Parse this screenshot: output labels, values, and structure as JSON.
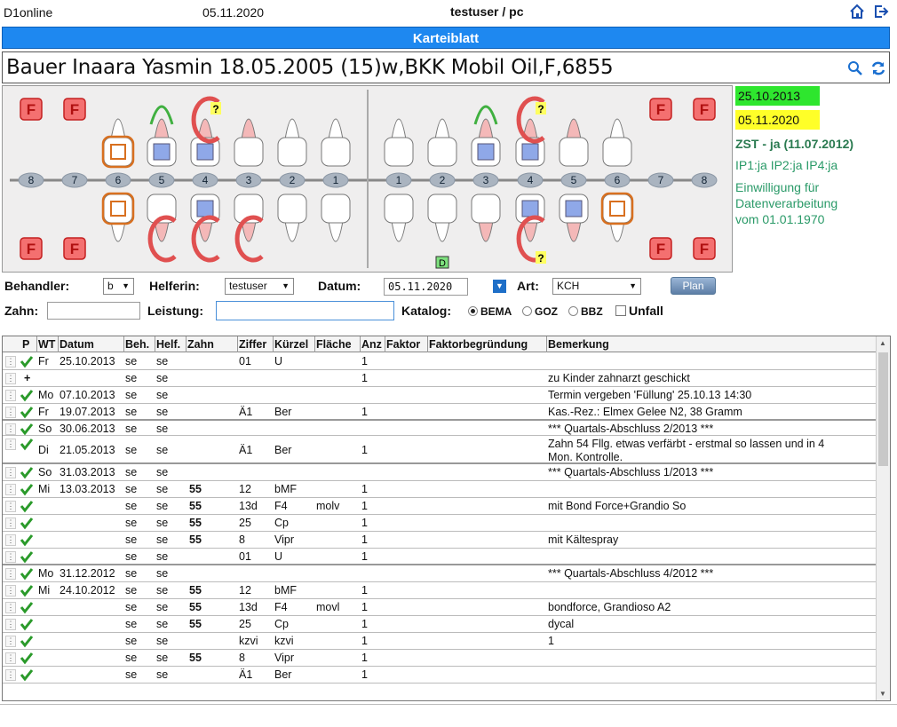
{
  "header": {
    "app": "D1online",
    "date": "05.11.2020",
    "user": "testuser / pc"
  },
  "title": "Karteiblatt",
  "patient": "Bauer Inaara Yasmin 18.05.2005 (15)w,BKK Mobil Oil,F,6855",
  "side": {
    "date1": "25.10.2013",
    "date2": "05.11.2020",
    "zst": "ZST - ja (11.07.2012)",
    "ip": "IP1:ja IP2:ja IP4:ja",
    "ein": [
      "Einwilligung für",
      "Datenverarbeitung",
      "vom 01.01.1970"
    ]
  },
  "teeth": {
    "numbers": [
      "8",
      "7",
      "6",
      "5",
      "4",
      "3",
      "2",
      "1",
      "1",
      "2",
      "3",
      "4",
      "5",
      "6",
      "7",
      "8"
    ],
    "marks": {
      "f": "F",
      "q": "?",
      "d": "D"
    }
  },
  "form": {
    "behandler_label": "Behandler:",
    "behandler_value": "b",
    "helferin_label": "Helferin:",
    "helferin_value": "testuser",
    "datum_label": "Datum:",
    "datum_value": "05.11.2020",
    "art_label": "Art:",
    "art_value": "KCH",
    "plan": "Plan",
    "zahn_label": "Zahn:",
    "leistung_label": "Leistung:",
    "katalog_label": "Katalog:",
    "radios": [
      "BEMA",
      "GOZ",
      "BBZ"
    ],
    "unfall": "Unfall"
  },
  "table": {
    "columns": [
      "P",
      "WT",
      "Datum",
      "Beh.",
      "Helf.",
      "Zahn",
      "Ziffer",
      "Kürzel",
      "Fläche",
      "Anz",
      "Faktor",
      "Faktorbegründung",
      "Bemerkung"
    ],
    "rows": [
      {
        "p": "check",
        "wt": "Fr",
        "datum": "25.10.2013",
        "beh": "se",
        "helf": "se",
        "zahn": "",
        "ziffer": "01",
        "kuerzel": "U",
        "flaeche": "",
        "anz": "1",
        "bem": ""
      },
      {
        "p": "plus",
        "wt": "",
        "datum": "",
        "beh": "se",
        "helf": "se",
        "zahn": "",
        "ziffer": "",
        "kuerzel": "",
        "flaeche": "",
        "anz": "1",
        "bem": "zu Kinder zahnarzt geschickt"
      },
      {
        "p": "check",
        "wt": "Mo",
        "datum": "07.10.2013",
        "beh": "se",
        "helf": "se",
        "zahn": "",
        "ziffer": "",
        "kuerzel": "",
        "flaeche": "",
        "anz": "",
        "bem": "Termin vergeben 'Füllung' 25.10.13 14:30"
      },
      {
        "p": "check",
        "wt": "Fr",
        "datum": "19.07.2013",
        "beh": "se",
        "helf": "se",
        "zahn": "",
        "ziffer": "Ä1",
        "kuerzel": "Ber",
        "flaeche": "",
        "anz": "1",
        "bem": "Kas.-Rez.: Elmex Gelee N2, 38 Gramm"
      },
      {
        "p": "check",
        "wt": "So",
        "datum": "30.06.2013",
        "beh": "se",
        "helf": "se",
        "zahn": "",
        "ziffer": "",
        "kuerzel": "",
        "flaeche": "",
        "anz": "",
        "bem": "*** Quartals-Abschluss 2/2013 ***"
      },
      {
        "p": "check",
        "wt": "Di",
        "datum": "21.05.2013",
        "beh": "se",
        "helf": "se",
        "zahn": "",
        "ziffer": "Ä1",
        "kuerzel": "Ber",
        "flaeche": "",
        "anz": "1",
        "bem": "Zahn 54 Fllg. etwas verfärbt - erstmal so lassen und in 4",
        "bem2": "Mon. Kontrolle."
      },
      {
        "p": "check",
        "wt": "So",
        "datum": "31.03.2013",
        "beh": "se",
        "helf": "se",
        "zahn": "",
        "ziffer": "",
        "kuerzel": "",
        "flaeche": "",
        "anz": "",
        "bem": "*** Quartals-Abschluss 1/2013 ***"
      },
      {
        "p": "check",
        "wt": "Mi",
        "datum": "13.03.2013",
        "beh": "se",
        "helf": "se",
        "zahn": "55",
        "ziffer": "12",
        "kuerzel": "bMF",
        "flaeche": "",
        "anz": "1",
        "bem": ""
      },
      {
        "p": "check",
        "wt": "",
        "datum": "",
        "beh": "se",
        "helf": "se",
        "zahn": "55",
        "ziffer": "13d",
        "kuerzel": "F4",
        "flaeche": "molv",
        "anz": "1",
        "bem": "mit Bond Force+Grandio So"
      },
      {
        "p": "check",
        "wt": "",
        "datum": "",
        "beh": "se",
        "helf": "se",
        "zahn": "55",
        "ziffer": "25",
        "kuerzel": "Cp",
        "flaeche": "",
        "anz": "1",
        "bem": ""
      },
      {
        "p": "check",
        "wt": "",
        "datum": "",
        "beh": "se",
        "helf": "se",
        "zahn": "55",
        "ziffer": "8",
        "kuerzel": "Vipr",
        "flaeche": "",
        "anz": "1",
        "bem": "mit Kältespray"
      },
      {
        "p": "check",
        "wt": "",
        "datum": "",
        "beh": "se",
        "helf": "se",
        "zahn": "",
        "ziffer": "01",
        "kuerzel": "U",
        "flaeche": "",
        "anz": "1",
        "bem": ""
      },
      {
        "p": "check",
        "wt": "Mo",
        "datum": "31.12.2012",
        "beh": "se",
        "helf": "se",
        "zahn": "",
        "ziffer": "",
        "kuerzel": "",
        "flaeche": "",
        "anz": "",
        "bem": "*** Quartals-Abschluss 4/2012 ***"
      },
      {
        "p": "check",
        "wt": "Mi",
        "datum": "24.10.2012",
        "beh": "se",
        "helf": "se",
        "zahn": "55",
        "ziffer": "12",
        "kuerzel": "bMF",
        "flaeche": "",
        "anz": "1",
        "bem": ""
      },
      {
        "p": "check",
        "wt": "",
        "datum": "",
        "beh": "se",
        "helf": "se",
        "zahn": "55",
        "ziffer": "13d",
        "kuerzel": "F4",
        "flaeche": "movl",
        "anz": "1",
        "bem": "bondforce, Grandioso A2"
      },
      {
        "p": "check",
        "wt": "",
        "datum": "",
        "beh": "se",
        "helf": "se",
        "zahn": "55",
        "ziffer": "25",
        "kuerzel": "Cp",
        "flaeche": "",
        "anz": "1",
        "bem": "dycal"
      },
      {
        "p": "check",
        "wt": "",
        "datum": "",
        "beh": "se",
        "helf": "se",
        "zahn": "",
        "ziffer": "kzvi",
        "kuerzel": "kzvi",
        "flaeche": "",
        "anz": "1",
        "bem": "1"
      },
      {
        "p": "check",
        "wt": "",
        "datum": "",
        "beh": "se",
        "helf": "se",
        "zahn": "55",
        "ziffer": "8",
        "kuerzel": "Vipr",
        "flaeche": "",
        "anz": "1",
        "bem": ""
      },
      {
        "p": "check",
        "wt": "",
        "datum": "",
        "beh": "se",
        "helf": "se",
        "zahn": "",
        "ziffer": "Ä1",
        "kuerzel": "Ber",
        "flaeche": "",
        "anz": "1",
        "bem": ""
      }
    ]
  }
}
